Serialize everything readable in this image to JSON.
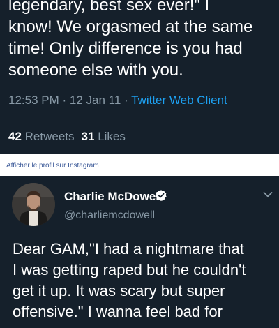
{
  "tweet_top": {
    "text_lines": "legendary, best sex ever!\" I\nknow! We orgasmed at the same\ntime! Only difference is you had\nsomeone else with you.",
    "time": "12:53 PM",
    "date": "12 Jan 11",
    "client": "Twitter Web Client",
    "retweet_count": "42",
    "retweet_label": "Retweets",
    "like_count": "31",
    "like_label": "Likes"
  },
  "instagram_link": "Afficher le profil sur Instagram",
  "tweet_bottom": {
    "display_name": "Charlie McDowell",
    "handle": "@charliemcdowell",
    "text_lines": "Dear GAM,\"I had a nightmare that\nI was getting raped but he couldn't\nget it up. It was scary but super\noffensive.\" I wanna feel bad for",
    "icons": [
      "avatar",
      "verified-badge-icon",
      "chevron-down-icon"
    ]
  },
  "colors": {
    "background": "#15202b",
    "text": "#ffffff",
    "muted": "#8899a6",
    "link": "#1da1f2",
    "verified": "#ffffff",
    "instagram_link": "#3b5998"
  }
}
